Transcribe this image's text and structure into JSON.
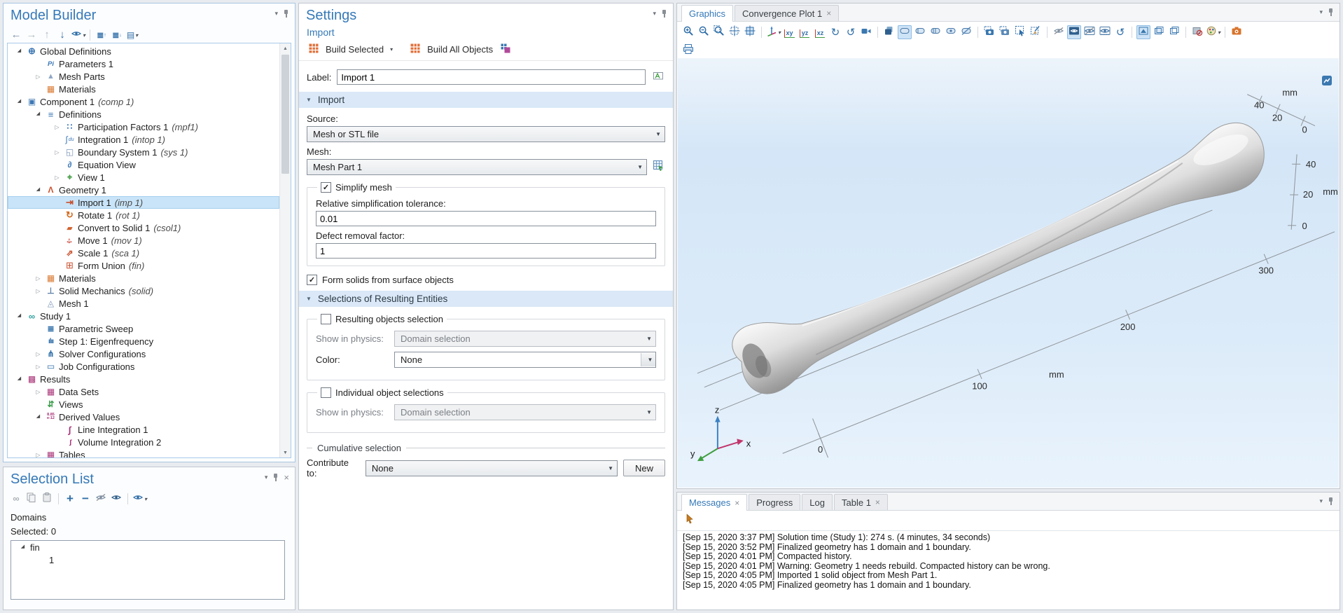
{
  "theme": {
    "accent": "#3579B8",
    "selection": "#C9E4F8",
    "section_header": "#DAE8F7",
    "canvas_blue": "#D4E6F7"
  },
  "model_builder": {
    "title": "Model Builder",
    "toolbar": [
      {
        "icon": "back-arrow-icon"
      },
      {
        "icon": "forward-arrow-icon"
      },
      {
        "icon": "move-up-icon"
      },
      {
        "icon": "move-down-icon"
      },
      {
        "icon": "show-options-icon",
        "dd": true
      },
      {
        "sep": true
      },
      {
        "icon": "collapse-all-icon"
      },
      {
        "icon": "expand-all-icon"
      },
      {
        "icon": "node-text-options-icon",
        "dd": true
      }
    ],
    "tree": [
      {
        "label": "Global Definitions",
        "level": 0,
        "state": "exp",
        "icon": "globe-icon"
      },
      {
        "label": "Parameters 1",
        "level": 1,
        "state": "leaf",
        "icon": "parameters-icon"
      },
      {
        "label": "Mesh Parts",
        "level": 1,
        "state": "col",
        "icon": "mesh-parts-icon"
      },
      {
        "label": "Materials",
        "level": 1,
        "state": "leaf",
        "icon": "materials-icon"
      },
      {
        "label": "Component 1",
        "tag": "(comp 1)",
        "level": 0,
        "state": "exp",
        "icon": "component-icon"
      },
      {
        "label": "Definitions",
        "level": 1,
        "state": "exp",
        "icon": "definitions-icon"
      },
      {
        "label": "Participation Factors 1",
        "tag": "(mpf1)",
        "level": 2,
        "state": "col",
        "icon": "participation-factors-icon"
      },
      {
        "label": "Integration 1",
        "tag": "(intop 1)",
        "level": 2,
        "state": "leaf",
        "icon": "integration-icon"
      },
      {
        "label": "Boundary System 1",
        "tag": "(sys 1)",
        "level": 2,
        "state": "col",
        "icon": "boundary-system-icon"
      },
      {
        "label": "Equation View",
        "level": 2,
        "state": "leaf",
        "icon": "equation-view-icon"
      },
      {
        "label": "View 1",
        "level": 2,
        "state": "col",
        "icon": "view-icon"
      },
      {
        "label": "Geometry 1",
        "level": 1,
        "state": "exp",
        "icon": "geometry-icon"
      },
      {
        "label": "Import 1",
        "tag": "(imp 1)",
        "level": 2,
        "state": "leaf",
        "icon": "import-icon",
        "sel": true
      },
      {
        "label": "Rotate 1",
        "tag": "(rot 1)",
        "level": 2,
        "state": "leaf",
        "icon": "rotate-icon"
      },
      {
        "label": "Convert to Solid 1",
        "tag": "(csol1)",
        "level": 2,
        "state": "leaf",
        "icon": "convert-to-solid-icon"
      },
      {
        "label": "Move 1",
        "tag": "(mov 1)",
        "level": 2,
        "state": "leaf",
        "icon": "move-icon"
      },
      {
        "label": "Scale 1",
        "tag": "(sca 1)",
        "level": 2,
        "state": "leaf",
        "icon": "scale-icon"
      },
      {
        "label": "Form Union",
        "tag": "(fin)",
        "level": 2,
        "state": "leaf",
        "icon": "form-union-icon"
      },
      {
        "label": "Materials",
        "level": 1,
        "state": "col",
        "icon": "materials-icon"
      },
      {
        "label": "Solid Mechanics",
        "tag": "(solid)",
        "level": 1,
        "state": "col",
        "icon": "solid-mechanics-icon"
      },
      {
        "label": "Mesh 1",
        "level": 1,
        "state": "leaf",
        "icon": "mesh-icon"
      },
      {
        "label": "Study 1",
        "level": 0,
        "state": "exp",
        "icon": "study-icon"
      },
      {
        "label": "Parametric Sweep",
        "level": 1,
        "state": "leaf",
        "icon": "parametric-sweep-icon"
      },
      {
        "label": "Step 1: Eigenfrequency",
        "level": 1,
        "state": "leaf",
        "icon": "eigenfrequency-icon"
      },
      {
        "label": "Solver Configurations",
        "level": 1,
        "state": "col",
        "icon": "solver-configurations-icon"
      },
      {
        "label": "Job Configurations",
        "level": 1,
        "state": "col",
        "icon": "job-configurations-icon"
      },
      {
        "label": "Results",
        "level": 0,
        "state": "exp",
        "icon": "results-icon"
      },
      {
        "label": "Data Sets",
        "level": 1,
        "state": "col",
        "icon": "data-sets-icon"
      },
      {
        "label": "Views",
        "level": 1,
        "state": "leaf",
        "icon": "views-icon"
      },
      {
        "label": "Derived Values",
        "level": 1,
        "state": "exp",
        "icon": "derived-values-icon"
      },
      {
        "label": "Line Integration 1",
        "level": 2,
        "state": "leaf",
        "icon": "line-integration-icon"
      },
      {
        "label": "Volume Integration 2",
        "level": 2,
        "state": "leaf",
        "icon": "volume-integration-icon"
      },
      {
        "label": "Tables",
        "level": 1,
        "state": "col",
        "icon": "tables-icon"
      }
    ]
  },
  "selection_list": {
    "title": "Selection List",
    "toolbar": [
      {
        "icon": "link-icon"
      },
      {
        "icon": "copy-icon"
      },
      {
        "icon": "paste-icon"
      },
      {
        "sep": true
      },
      {
        "icon": "add-icon"
      },
      {
        "icon": "remove-icon"
      },
      {
        "icon": "hide-eye-icon"
      },
      {
        "icon": "eye-icon"
      },
      {
        "sep": true
      },
      {
        "icon": "show-options-icon",
        "dd": true
      }
    ],
    "domains_label": "Domains",
    "selected_label": "Selected: 0",
    "list": [
      {
        "label": "fin",
        "level": 0,
        "state": "exp"
      },
      {
        "label": "1",
        "level": 1,
        "state": "leaf"
      }
    ]
  },
  "settings": {
    "title": "Settings",
    "subtitle": "Import",
    "toolbar": {
      "build_selected": "Build Selected",
      "build_all": "Build All Objects"
    },
    "label_field": {
      "label": "Label:",
      "value": "Import 1"
    },
    "import_section": {
      "title": "Import",
      "source_label": "Source:",
      "source_value": "Mesh or STL file",
      "mesh_label": "Mesh:",
      "mesh_value": "Mesh Part 1",
      "simplify_label": "Simplify mesh",
      "rel_tol_label": "Relative simplification tolerance:",
      "rel_tol_value": "0.01",
      "defect_label": "Defect removal factor:",
      "defect_value": "1",
      "form_solids_label": "Form solids from surface objects"
    },
    "selections_section": {
      "title": "Selections of Resulting Entities",
      "resulting_label": "Resulting objects selection",
      "show_in_physics_label": "Show in physics:",
      "show_in_physics_value": "Domain selection",
      "color_label": "Color:",
      "color_value": "None",
      "individual_label": "Individual object selections",
      "show_in_physics2_label": "Show in physics:",
      "show_in_physics2_value": "Domain selection",
      "cumulative_label": "Cumulative selection",
      "contribute_label": "Contribute to: ",
      "contribute_value": "None",
      "new_button": "New"
    }
  },
  "graphics": {
    "tabs": [
      {
        "label": "Graphics",
        "active": true
      },
      {
        "label": "Convergence Plot 1",
        "closable": true
      }
    ],
    "toolbar_row1": [
      {
        "icon": "zoom-in-icon"
      },
      {
        "icon": "zoom-out-icon"
      },
      {
        "icon": "zoom-box-icon"
      },
      {
        "icon": "zoom-extents-icon"
      },
      {
        "icon": "zoom-selected-icon"
      },
      {
        "sep": true
      },
      {
        "icon": "default-3d-view-icon",
        "dd": true
      },
      {
        "icon": "view-xy-icon"
      },
      {
        "icon": "view-yz-icon"
      },
      {
        "icon": "view-xz-icon"
      },
      {
        "icon": "rotate-cw-icon"
      },
      {
        "icon": "rotate-ccw-icon"
      },
      {
        "icon": "camera-view-icon"
      },
      {
        "sep": true
      },
      {
        "icon": "scene-light-group-icon"
      },
      {
        "icon": "scene-light-icon",
        "sel": true
      },
      {
        "icon": "headlight-icon"
      },
      {
        "icon": "directional-light-icon"
      },
      {
        "icon": "ambient-light-icon"
      },
      {
        "icon": "no-light-icon"
      },
      {
        "sep": true
      },
      {
        "icon": "image-snapshot-icon"
      },
      {
        "icon": "image-snapshot-alt-icon"
      },
      {
        "icon": "select-box-icon"
      },
      {
        "icon": "clear-selection-icon"
      },
      {
        "sep": true
      },
      {
        "icon": "hide-eye-slash-icon"
      },
      {
        "icon": "show-all-icon",
        "sel": true
      },
      {
        "icon": "hide-objects-icon"
      },
      {
        "icon": "show-selected-icon"
      },
      {
        "icon": "reset-hiding-icon"
      },
      {
        "sep": true
      },
      {
        "icon": "view-solid-icon",
        "sel": true
      },
      {
        "icon": "view-wireframe-icon"
      },
      {
        "icon": "view-transparent-icon"
      },
      {
        "sep": true
      },
      {
        "icon": "material-rendering-icon"
      },
      {
        "icon": "color-appearance-icon",
        "dd": true
      },
      {
        "sep": true
      },
      {
        "icon": "scene-snapshot-icon"
      }
    ],
    "toolbar_row2": [
      {
        "icon": "print-icon"
      }
    ],
    "scene": {
      "x_ticks": [
        "0",
        "100",
        "200",
        "300"
      ],
      "x_unit": "mm",
      "top_ticks": [
        "40",
        "20",
        "0"
      ],
      "top_unit": "mm",
      "right_ticks": [
        "40",
        "20",
        "0"
      ],
      "right_unit": "mm",
      "triad": {
        "x": "x",
        "y": "y",
        "z": "z"
      }
    }
  },
  "messages": {
    "tabs": [
      {
        "label": "Messages",
        "active": true,
        "closable": true
      },
      {
        "label": "Progress"
      },
      {
        "label": "Log"
      },
      {
        "label": "Table 1",
        "closable": true
      }
    ],
    "toolbar": [
      {
        "icon": "pointer-icon"
      }
    ],
    "lines": [
      "[Sep 15, 2020 3:37 PM] Solution time (Study 1): 274 s. (4 minutes, 34 seconds)",
      "[Sep 15, 2020 3:52 PM] Finalized geometry has 1 domain and 1 boundary.",
      "[Sep 15, 2020 4:01 PM] Compacted history.",
      "[Sep 15, 2020 4:01 PM] Warning: Geometry 1 needs rebuild. Compacted history can be wrong.",
      "[Sep 15, 2020 4:05 PM] Imported 1 solid object from Mesh Part 1.",
      "[Sep 15, 2020 4:05 PM] Finalized geometry has 1 domain and 1 boundary."
    ]
  }
}
